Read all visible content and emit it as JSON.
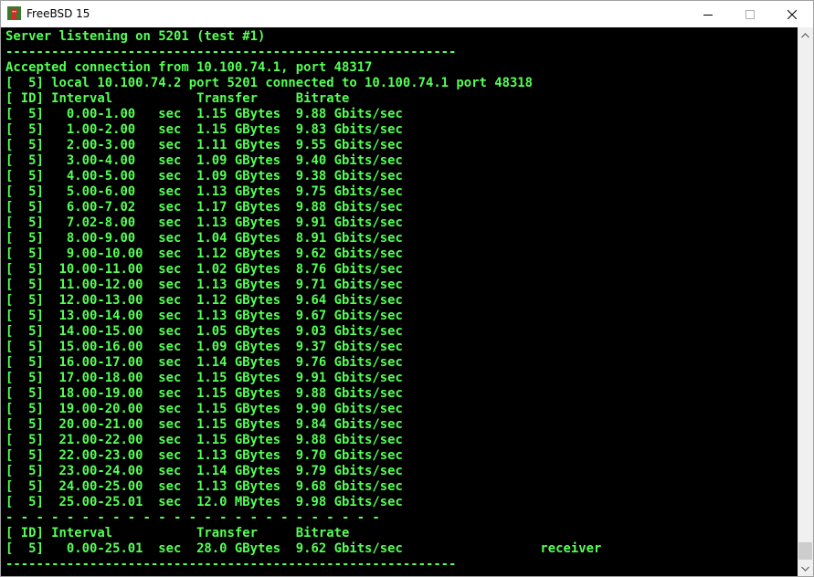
{
  "window": {
    "title": "FreeBSD 15",
    "icon": "freebsd-daemon-icon",
    "controls": [
      "minimize-icon",
      "maximize-icon",
      "close-icon"
    ]
  },
  "terminal": {
    "foreground": "#55ff55",
    "background": "#000000",
    "lines": [
      "Server listening on 5201 (test #1)",
      "-----------------------------------------------------------",
      "Accepted connection from 10.100.74.1, port 48317",
      "[  5] local 10.100.74.2 port 5201 connected to 10.100.74.1 port 48318",
      "[ ID] Interval           Transfer     Bitrate",
      "[  5]   0.00-1.00   sec  1.15 GBytes  9.88 Gbits/sec",
      "[  5]   1.00-2.00   sec  1.15 GBytes  9.83 Gbits/sec",
      "[  5]   2.00-3.00   sec  1.11 GBytes  9.55 Gbits/sec",
      "[  5]   3.00-4.00   sec  1.09 GBytes  9.40 Gbits/sec",
      "[  5]   4.00-5.00   sec  1.09 GBytes  9.38 Gbits/sec",
      "[  5]   5.00-6.00   sec  1.13 GBytes  9.75 Gbits/sec",
      "[  5]   6.00-7.02   sec  1.17 GBytes  9.88 Gbits/sec",
      "[  5]   7.02-8.00   sec  1.13 GBytes  9.91 Gbits/sec",
      "[  5]   8.00-9.00   sec  1.04 GBytes  8.91 Gbits/sec",
      "[  5]   9.00-10.00  sec  1.12 GBytes  9.62 Gbits/sec",
      "[  5]  10.00-11.00  sec  1.02 GBytes  8.76 Gbits/sec",
      "[  5]  11.00-12.00  sec  1.13 GBytes  9.71 Gbits/sec",
      "[  5]  12.00-13.00  sec  1.12 GBytes  9.64 Gbits/sec",
      "[  5]  13.00-14.00  sec  1.13 GBytes  9.67 Gbits/sec",
      "[  5]  14.00-15.00  sec  1.05 GBytes  9.03 Gbits/sec",
      "[  5]  15.00-16.00  sec  1.09 GBytes  9.37 Gbits/sec",
      "[  5]  16.00-17.00  sec  1.14 GBytes  9.76 Gbits/sec",
      "[  5]  17.00-18.00  sec  1.15 GBytes  9.91 Gbits/sec",
      "[  5]  18.00-19.00  sec  1.15 GBytes  9.88 Gbits/sec",
      "[  5]  19.00-20.00  sec  1.15 GBytes  9.90 Gbits/sec",
      "[  5]  20.00-21.00  sec  1.15 GBytes  9.84 Gbits/sec",
      "[  5]  21.00-22.00  sec  1.15 GBytes  9.88 Gbits/sec",
      "[  5]  22.00-23.00  sec  1.13 GBytes  9.70 Gbits/sec",
      "[  5]  23.00-24.00  sec  1.14 GBytes  9.79 Gbits/sec",
      "[  5]  24.00-25.00  sec  1.13 GBytes  9.68 Gbits/sec",
      "[  5]  25.00-25.01  sec  12.0 MBytes  9.98 Gbits/sec",
      "- - - - - - - - - - - - - - - - - - - - - - - - -",
      "[ ID] Interval           Transfer     Bitrate",
      "[  5]   0.00-25.01  sec  28.0 GBytes  9.62 Gbits/sec                  receiver",
      "-----------------------------------------------------------"
    ]
  },
  "scrollbar": {
    "position": "bottom"
  }
}
